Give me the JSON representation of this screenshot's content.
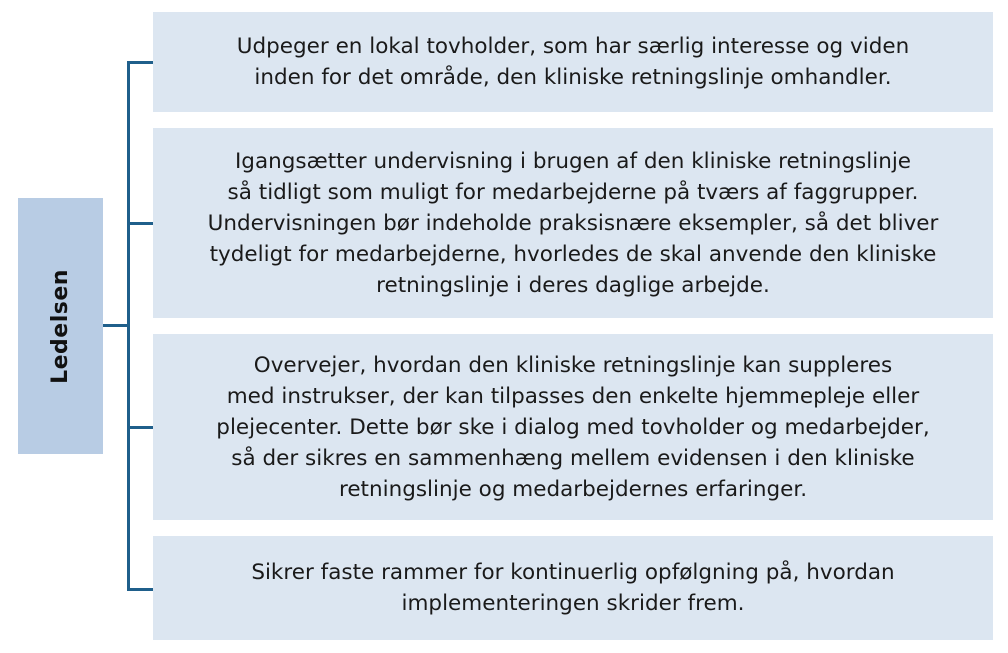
{
  "root": {
    "label": "Ledelsen"
  },
  "items": [
    {
      "text": "Udpeger en lokal tovholder, som har særlig interesse og viden\ninden for det område, den kliniske retningslinje omhandler."
    },
    {
      "text": "Igangsætter undervisning i brugen af den kliniske retningslinje\nså tidligt som muligt for medarbejderne på tværs af faggrupper.\nUndervisningen bør indeholde praksisnære eksempler, så det bliver\ntydeligt for medarbejderne, hvorledes de skal anvende den kliniske\nretningslinje i deres daglige arbejde."
    },
    {
      "text": "Overvejer, hvordan den kliniske retningslinje kan suppleres\nmed instrukser, der kan tilpasses den enkelte hjemmepleje eller\nplejecenter. Dette bør ske i dialog med tovholder og medarbejder,\nså der sikres en sammenhæng mellem evidensen i den kliniske\nretningslinje og medarbejdernes erfaringer."
    },
    {
      "text": "Sikrer faste rammer for kontinuerlig opfølgning på, hvordan\nimplementeringen skrider frem."
    }
  ],
  "colors": {
    "root_fill": "#b8cce4",
    "item_fill": "#dce6f1",
    "connector": "#1f5f8b"
  }
}
